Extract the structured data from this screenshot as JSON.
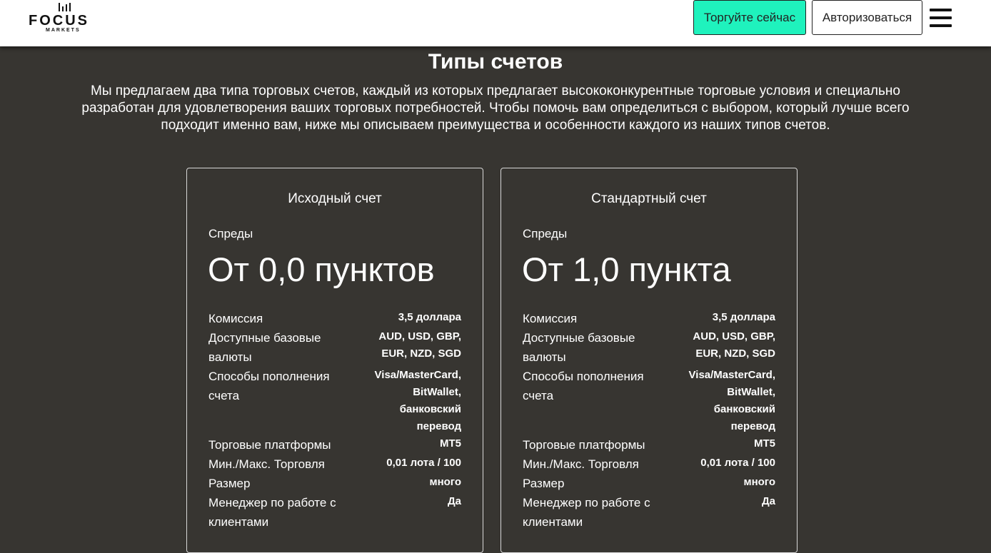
{
  "header": {
    "logo": {
      "name": "FOCUS",
      "sub": "MARKETS"
    },
    "trade_label": "Торгуйте сейчас",
    "login_label": "Авторизоваться"
  },
  "section": {
    "title": "Типы счетов",
    "intro": "Мы предлагаем два типа торговых счетов, каждый из которых предлагает высококонкурентные торговые условия и специально разработан для удовлетворения ваших торговых потребностей. Чтобы помочь вам определиться с выбором, который лучше всего подходит именно вам, ниже мы описываем преимущества и особенности каждого из наших типов счетов."
  },
  "accounts": [
    {
      "title": "Исходный счет",
      "spread_label": "Спреды",
      "spread_value": "От 0,0 пунктов",
      "rows": [
        {
          "label": "Комиссия",
          "value": "3,5 доллара"
        },
        {
          "label": "Доступные базовые валюты",
          "value": "AUD, USD, GBP, EUR, NZD, SGD"
        },
        {
          "label": "Способы пополнения счета",
          "value": "Visa/MasterCard, BitWallet, банковский перевод"
        },
        {
          "label": "Торговые платформы",
          "value": "MT5"
        },
        {
          "label": "Мин./Макс. Торговля",
          "value": "0,01 лота / 100"
        },
        {
          "label": "Размер",
          "value": "много"
        },
        {
          "label": "Менеджер по работе с клиентами",
          "value": "Да"
        }
      ]
    },
    {
      "title": "Стандартный счет",
      "spread_label": "Спреды",
      "spread_value": "От 1,0 пункта",
      "rows": [
        {
          "label": "Комиссия",
          "value": "3,5 доллара"
        },
        {
          "label": "Доступные базовые валюты",
          "value": "AUD, USD, GBP, EUR, NZD, SGD"
        },
        {
          "label": "Способы пополнения счета",
          "value": "Visa/MasterCard, BitWallet, банковский перевод"
        },
        {
          "label": "Торговые платформы",
          "value": "MT5"
        },
        {
          "label": "Мин./Макс. Торговля",
          "value": "0,01 лота / 100"
        },
        {
          "label": "Размер",
          "value": "много"
        },
        {
          "label": "Менеджер по работе с клиентами",
          "value": "Да"
        }
      ]
    }
  ]
}
